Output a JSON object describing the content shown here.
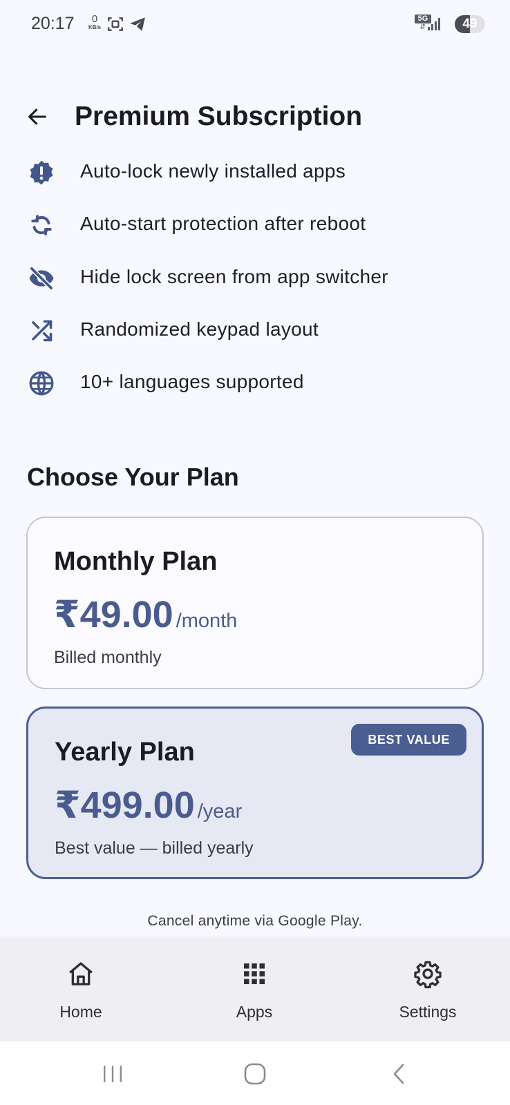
{
  "status_bar": {
    "time": "20:17",
    "net_speed_value": "0",
    "net_speed_unit": "KB/s",
    "network_type": "5G",
    "battery_level": "49",
    "battery_fraction": 0.49
  },
  "header": {
    "title": "Premium Subscription",
    "back_icon": "arrow-left-icon"
  },
  "features": [
    {
      "icon": "alert-badge-icon",
      "label": "Auto-lock newly installed apps"
    },
    {
      "icon": "sync-icon",
      "label": "Auto-start protection after reboot"
    },
    {
      "icon": "eye-off-icon",
      "label": "Hide lock screen from app switcher"
    },
    {
      "icon": "shuffle-icon",
      "label": "Randomized keypad layout"
    },
    {
      "icon": "globe-icon",
      "label": "10+ languages supported"
    }
  ],
  "plans_section": {
    "title": "Choose Your Plan"
  },
  "plans": [
    {
      "name": "Monthly Plan",
      "price": "₹49.00",
      "period": "/month",
      "description": "Billed monthly",
      "badge": ""
    },
    {
      "name": "Yearly Plan",
      "price": "₹499.00",
      "period": "/year",
      "description": "Best value — billed yearly",
      "badge": "BEST VALUE",
      "selected": true
    }
  ],
  "footer_note": "Cancel anytime via Google Play.",
  "bottom_nav": [
    {
      "icon": "home-icon",
      "label": "Home"
    },
    {
      "icon": "apps-grid-icon",
      "label": "Apps"
    },
    {
      "icon": "settings-gear-icon",
      "label": "Settings"
    }
  ],
  "colors": {
    "background": "#f8f9ff",
    "primary": "#4b5e92",
    "selected_card": "#e6e8f4",
    "nav_background": "#eeeef3",
    "text": "#1b1c22"
  }
}
